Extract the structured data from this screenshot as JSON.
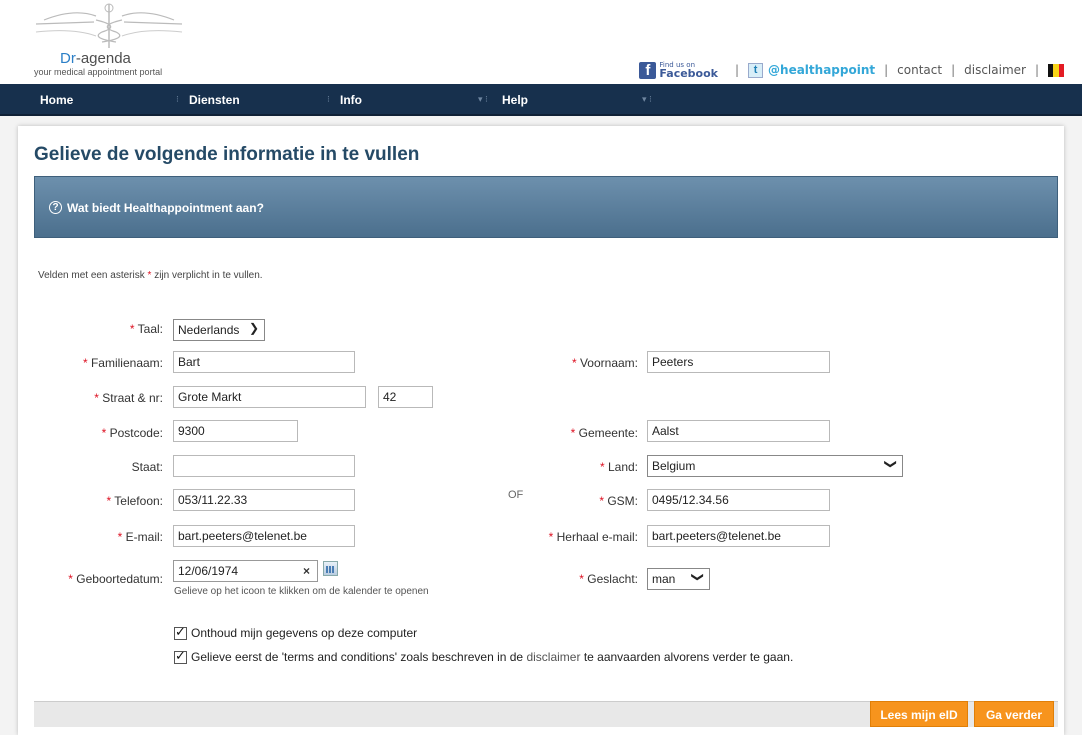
{
  "header": {
    "logo_brand_prefix": "Dr",
    "logo_brand_suffix": "-agenda",
    "logo_tagline": "your medical appointment portal",
    "facebook_small": "Find us on",
    "facebook_big": "Facebook",
    "twitter_handle": "@healthappoint",
    "contact": "contact",
    "disclaimer": "disclaimer"
  },
  "nav": {
    "items": [
      "Home",
      "Diensten",
      "Info",
      "Help"
    ]
  },
  "page": {
    "title": "Gelieve de volgende informatie in te vullen",
    "info_bar": "Wat biedt Healthappointment aan?",
    "required_note_prefix": "Velden met een asterisk",
    "required_note_suffix": "zijn verplicht in te vullen."
  },
  "form": {
    "asterisk": "*",
    "taal_label": "Taal:",
    "taal_value": "Nederlands",
    "familienaam_label": "Familienaam:",
    "familienaam_value": "Bart",
    "voornaam_label": "Voornaam:",
    "voornaam_value": "Peeters",
    "straat_label": "Straat & nr:",
    "straat_value": "Grote Markt",
    "nr_value": "42",
    "postcode_label": "Postcode:",
    "postcode_value": "9300",
    "gemeente_label": "Gemeente:",
    "gemeente_value": "Aalst",
    "staat_label": "Staat:",
    "staat_value": "",
    "land_label": "Land:",
    "land_value": "Belgium",
    "telefoon_label": "Telefoon:",
    "telefoon_value": "053/11.22.33",
    "of_text": "OF",
    "gsm_label": "GSM:",
    "gsm_value": "0495/12.34.56",
    "email_label": "E-mail:",
    "email_value": "bart.peeters@telenet.be",
    "herhaal_label": "Herhaal e-mail:",
    "herhaal_value": "bart.peeters@telenet.be",
    "geboortedatum_label": "Geboortedatum:",
    "geboortedatum_value": "12/06/1974",
    "clear_symbol": "×",
    "calendar_hint": "Gelieve op het icoon te klikken om de kalender te openen",
    "geslacht_label": "Geslacht:",
    "geslacht_value": "man",
    "remember_label": "Onthoud mijn gegevens op deze computer",
    "terms_prefix": "Gelieve eerst de 'terms and conditions' zoals beschreven in de",
    "terms_link": "disclaimer",
    "terms_suffix": "te aanvaarden alvorens verder te gaan."
  },
  "buttons": {
    "read_eid": "Lees mijn eID",
    "continue": "Ga verder"
  },
  "colors": {
    "nav_bg": "#17304d",
    "accent_orange": "#f7941d",
    "title_blue": "#254a66",
    "required_red": "#d12"
  }
}
